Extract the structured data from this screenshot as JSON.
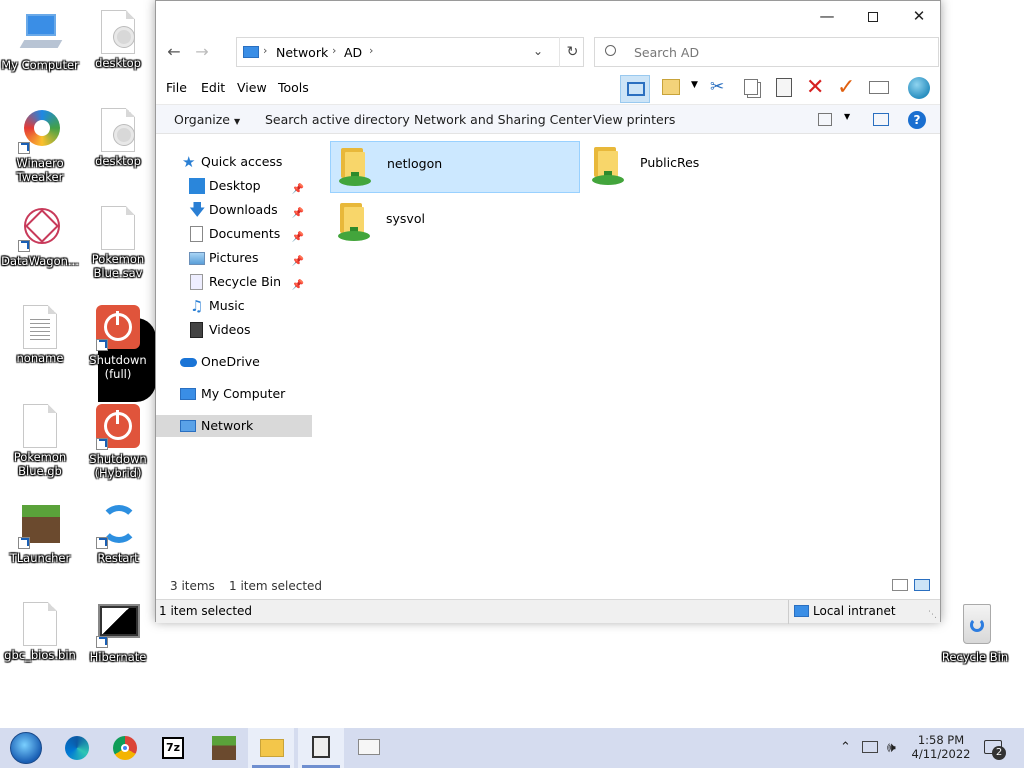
{
  "desktop": {
    "icons": [
      {
        "label": "My Computer"
      },
      {
        "label": "desktop"
      },
      {
        "label": "Winaero Tweaker"
      },
      {
        "label": "desktop"
      },
      {
        "label": "DataWagon..."
      },
      {
        "label": "Pokemon Blue.sav"
      },
      {
        "label": "noname"
      },
      {
        "label": "Shutdown (full)"
      },
      {
        "label": "Pokemon Blue.gb"
      },
      {
        "label": "Shutdown (Hybrid)"
      },
      {
        "label": "TLauncher"
      },
      {
        "label": "Restart"
      },
      {
        "label": "gbc_bios.bin"
      },
      {
        "label": "Hibernate"
      },
      {
        "label": "Recycle Bin"
      }
    ]
  },
  "window": {
    "breadcrumb": [
      "Network",
      "AD"
    ],
    "search_placeholder": "Search AD",
    "menu": [
      "File",
      "Edit",
      "View",
      "Tools"
    ],
    "commands": [
      "Organize",
      "Search active directory",
      "Network and Sharing Center",
      "View printers"
    ],
    "nav": {
      "quick_access": "Quick access",
      "items": [
        {
          "label": "Desktop",
          "pinned": true
        },
        {
          "label": "Downloads",
          "pinned": true
        },
        {
          "label": "Documents",
          "pinned": true
        },
        {
          "label": "Pictures",
          "pinned": true
        },
        {
          "label": "Recycle Bin",
          "pinned": true
        },
        {
          "label": "Music",
          "pinned": false
        },
        {
          "label": "Videos",
          "pinned": false
        }
      ],
      "onedrive": "OneDrive",
      "my_computer": "My Computer",
      "network": "Network"
    },
    "items": [
      {
        "name": "netlogon",
        "selected": true
      },
      {
        "name": "PublicRes",
        "selected": false
      },
      {
        "name": "sysvol",
        "selected": false
      }
    ],
    "status": {
      "count": "3 items",
      "selected": "1 item selected",
      "bottom_left": "1 item selected",
      "zone": "Local intranet"
    }
  },
  "taskbar": {
    "time": "1:58 PM",
    "date": "4/11/2022",
    "notifications": "2",
    "apps": [
      "start",
      "edge",
      "chrome",
      "7-zip",
      "minecraft",
      "file-explorer",
      "app",
      "monitor"
    ]
  },
  "colors": {
    "selection_bg": "#cce8ff",
    "selection_border": "#99d1ff",
    "nav_selected": "#d9d9d9",
    "taskbar": "#d5dcef",
    "accent_blue": "#0066cc"
  }
}
